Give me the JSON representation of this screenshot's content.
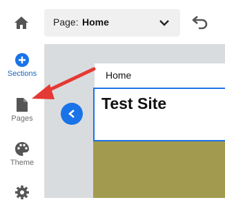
{
  "toolbar": {
    "page_label": "Page:",
    "page_value": "Home"
  },
  "nav": {
    "items": [
      {
        "label": "Sections",
        "icon": "plus-circle-icon",
        "active": true
      },
      {
        "label": "Pages",
        "icon": "page-icon"
      },
      {
        "label": "Theme",
        "icon": "palette-icon"
      },
      {
        "label": "",
        "icon": "gear-icon"
      }
    ]
  },
  "canvas": {
    "page_tab": "Home",
    "site_title": "Test Site"
  },
  "colors": {
    "accent": "#1a73e8",
    "arrow": "#e53935",
    "site_body": "#a29a4e"
  }
}
